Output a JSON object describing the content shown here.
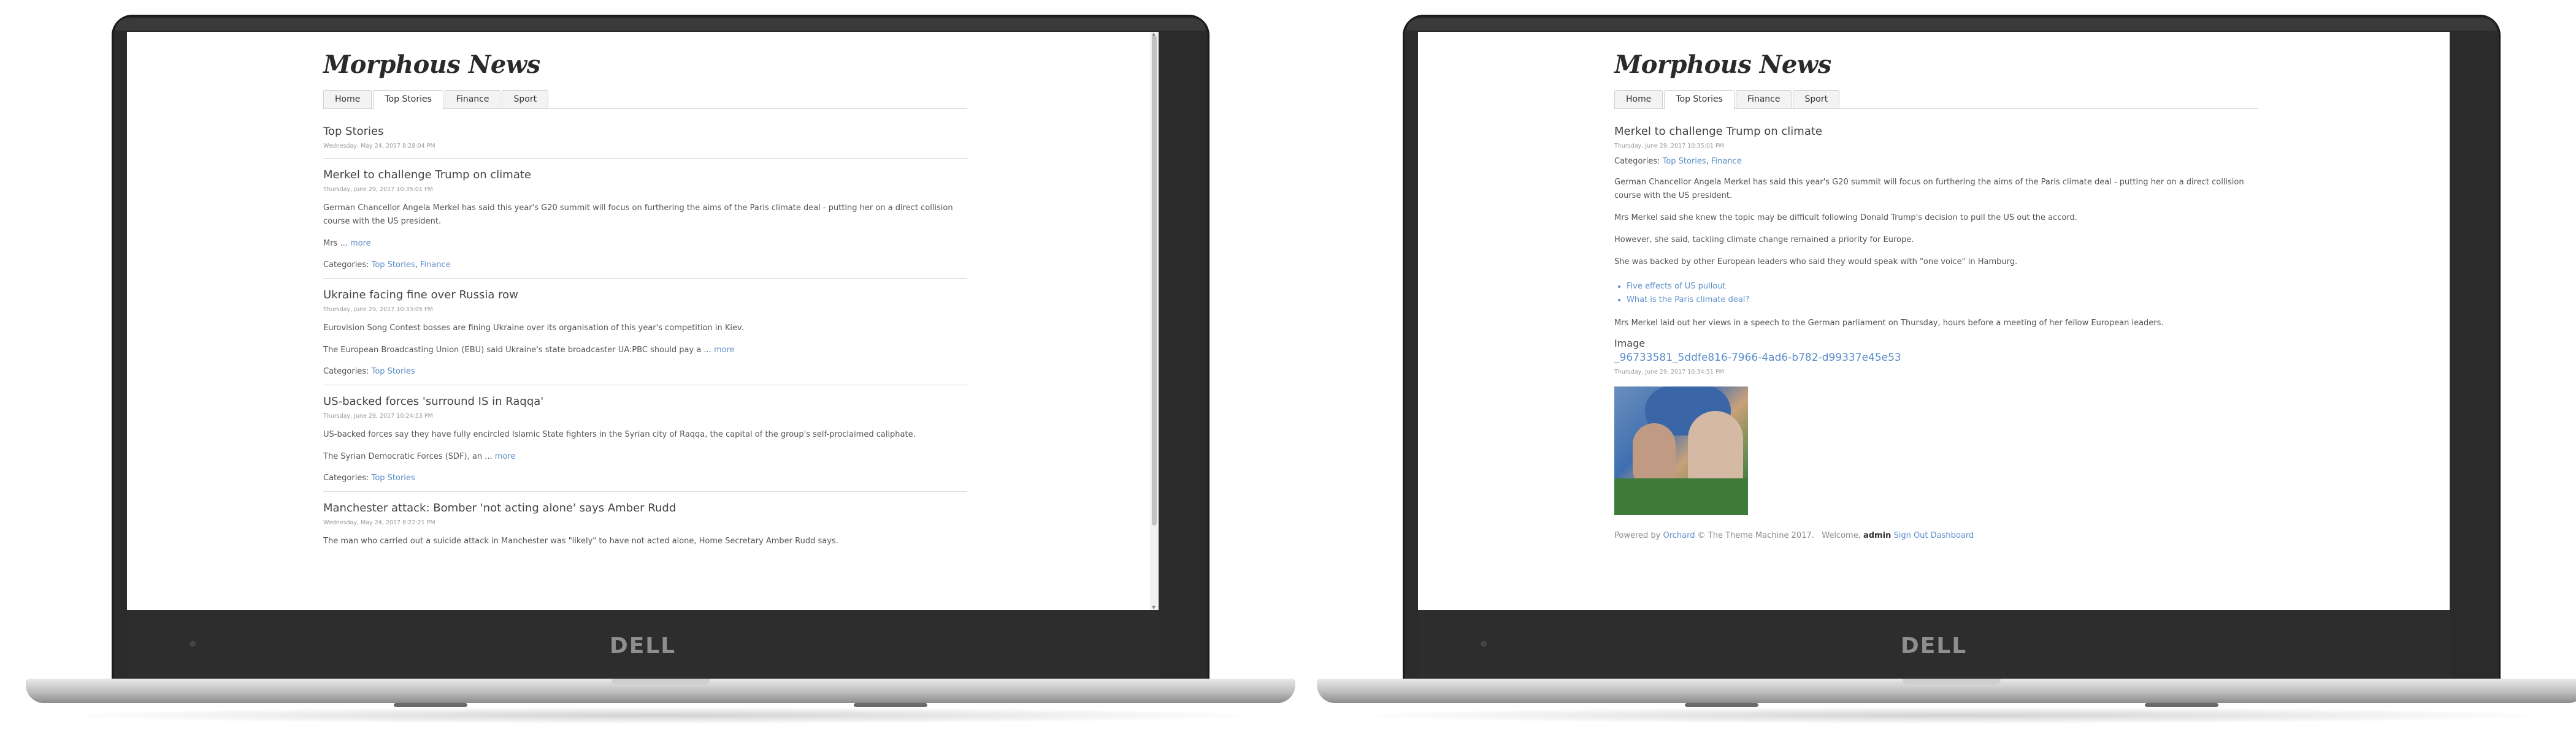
{
  "device_brand": "DELL",
  "site": {
    "title": "Morphous News",
    "tabs": [
      "Home",
      "Top Stories",
      "Finance",
      "Sport"
    ]
  },
  "left": {
    "active_tab": 1,
    "section_title": "Top Stories",
    "section_stamp": "Wednesday, May 24, 2017 8:28:04 PM",
    "more_label": "more",
    "categories_label": "Categories:",
    "articles": [
      {
        "title": "Merkel to challenge Trump on climate",
        "stamp": "Thursday, June 29, 2017 10:35:01 PM",
        "para1": "German Chancellor Angela Merkel has said this year's G20 summit will focus on furthering the aims of the Paris climate deal - putting her on a direct collision course with the US president.",
        "para2": "Mrs ... ",
        "cat1": "Top Stories",
        "cat2": "Finance"
      },
      {
        "title": "Ukraine facing fine over Russia row",
        "stamp": "Thursday, June 29, 2017 10:33:05 PM",
        "para1": "Eurovision Song Contest bosses are fining Ukraine over its organisation of this year's competition in Kiev.",
        "para2": "The European Broadcasting Union (EBU) said Ukraine's state broadcaster UA:PBC should pay a ... ",
        "cat1": "Top Stories"
      },
      {
        "title": "US-backed forces 'surround IS in Raqqa'",
        "stamp": "Thursday, June 29, 2017 10:24:53 PM",
        "para1": "US-backed forces say they have fully encircled Islamic State fighters in the Syrian city of Raqqa, the capital of the group's self-proclaimed caliphate.",
        "para2": "The Syrian Democratic Forces (SDF), an ... ",
        "cat1": "Top Stories"
      },
      {
        "title": "Manchester attack: Bomber 'not acting alone' says Amber Rudd",
        "stamp": "Wednesday, May 24, 2017 8:22:21 PM",
        "para1": "The man who carried out a suicide attack in Manchester was \"likely\" to have not acted alone, Home Secretary Amber Rudd says."
      }
    ]
  },
  "right": {
    "active_tab": 1,
    "title": "Merkel to challenge Trump on climate",
    "stamp": "Thursday, June 29, 2017 10:35:01 PM",
    "categories_label": "Categories:",
    "cat1": "Top Stories",
    "cat2": "Finance",
    "paragraphs": [
      "German Chancellor Angela Merkel has said this year's G20 summit will focus on furthering the aims of the Paris climate deal - putting her on a direct collision course with the US president.",
      "Mrs Merkel said she knew the topic may be difficult following Donald Trump's decision to pull the US out the accord.",
      "However, she said, tackling climate change remained a priority for Europe.",
      "She was backed by other European leaders who said they would speak with \"one voice\" in Hamburg."
    ],
    "links": [
      "Five effects of US pullout",
      "What is the Paris climate deal?"
    ],
    "closing": "Mrs Merkel laid out her views in a speech to the German parliament on Thursday, hours before a meeting of her fellow European leaders.",
    "image_label": "Image",
    "image_link": "_96733581_5ddfe816-7966-4ad6-b782-d99337e45e53",
    "image_stamp": "Thursday, June 29, 2017 10:34:51 PM",
    "footer": {
      "powered": "Powered by ",
      "orchard": "Orchard",
      "theme": " © The Theme Machine 2017.",
      "welcome": "Welcome, ",
      "user": "admin",
      "signout": "Sign Out",
      "dashboard": "Dashboard"
    }
  }
}
